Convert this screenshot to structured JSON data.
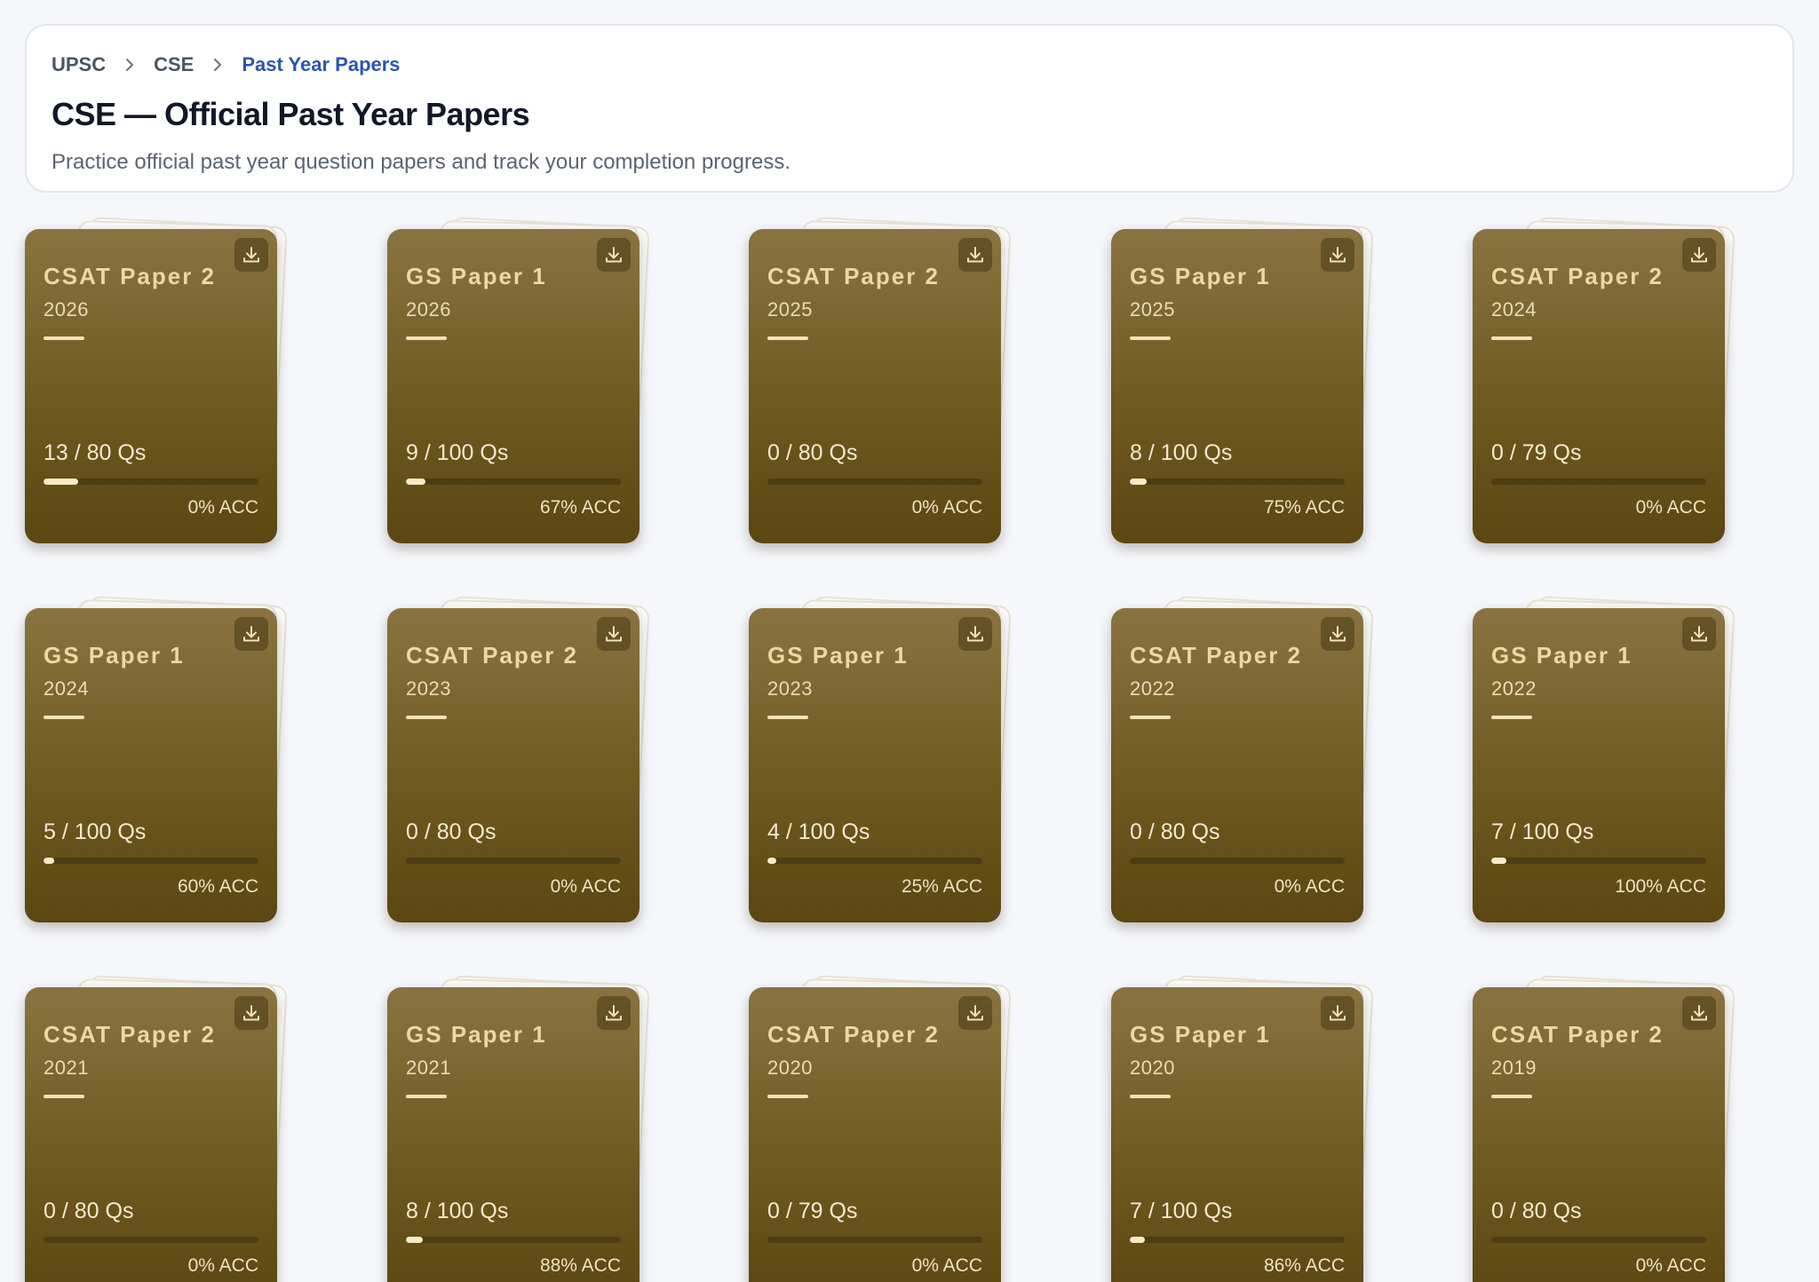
{
  "breadcrumb": [
    {
      "label": "UPSC"
    },
    {
      "label": "CSE"
    },
    {
      "label": "Past Year Papers"
    }
  ],
  "header": {
    "title": "CSE — Official Past Year Papers",
    "subtitle": "Practice official past year question papers and track your completion progress."
  },
  "papers": [
    {
      "title": "CSAT Paper 2",
      "year": "2026",
      "qs": "13 / 80 Qs",
      "done": 13,
      "total": 80,
      "acc": "0% ACC"
    },
    {
      "title": "GS Paper 1",
      "year": "2026",
      "qs": "9 / 100 Qs",
      "done": 9,
      "total": 100,
      "acc": "67% ACC"
    },
    {
      "title": "CSAT Paper 2",
      "year": "2025",
      "qs": "0 / 80 Qs",
      "done": 0,
      "total": 80,
      "acc": "0% ACC"
    },
    {
      "title": "GS Paper 1",
      "year": "2025",
      "qs": "8 / 100 Qs",
      "done": 8,
      "total": 100,
      "acc": "75% ACC"
    },
    {
      "title": "CSAT Paper 2",
      "year": "2024",
      "qs": "0 / 79 Qs",
      "done": 0,
      "total": 79,
      "acc": "0% ACC"
    },
    {
      "title": "GS Paper 1",
      "year": "2024",
      "qs": "5 / 100 Qs",
      "done": 5,
      "total": 100,
      "acc": "60% ACC"
    },
    {
      "title": "CSAT Paper 2",
      "year": "2023",
      "qs": "0 / 80 Qs",
      "done": 0,
      "total": 80,
      "acc": "0% ACC"
    },
    {
      "title": "GS Paper 1",
      "year": "2023",
      "qs": "4 / 100 Qs",
      "done": 4,
      "total": 100,
      "acc": "25% ACC"
    },
    {
      "title": "CSAT Paper 2",
      "year": "2022",
      "qs": "0 / 80 Qs",
      "done": 0,
      "total": 80,
      "acc": "0% ACC"
    },
    {
      "title": "GS Paper 1",
      "year": "2022",
      "qs": "7 / 100 Qs",
      "done": 7,
      "total": 100,
      "acc": "100% ACC"
    },
    {
      "title": "CSAT Paper 2",
      "year": "2021",
      "qs": "0 / 80 Qs",
      "done": 0,
      "total": 80,
      "acc": "0% ACC"
    },
    {
      "title": "GS Paper 1",
      "year": "2021",
      "qs": "8 / 100 Qs",
      "done": 8,
      "total": 100,
      "acc": "88% ACC"
    },
    {
      "title": "CSAT Paper 2",
      "year": "2020",
      "qs": "0 / 79 Qs",
      "done": 0,
      "total": 79,
      "acc": "0% ACC"
    },
    {
      "title": "GS Paper 1",
      "year": "2020",
      "qs": "7 / 100 Qs",
      "done": 7,
      "total": 100,
      "acc": "86% ACC"
    },
    {
      "title": "CSAT Paper 2",
      "year": "2019",
      "qs": "0 / 80 Qs",
      "done": 0,
      "total": 80,
      "acc": "0% ACC"
    }
  ],
  "icons": {
    "breadcrumb_separator": "chevron-right-icon",
    "card_action": "download-icon"
  },
  "colors": {
    "breadcrumb_active": "#2b55b5",
    "card_top": "#8a7341",
    "card_bottom": "#5c4612",
    "card_title": "#ecd9a0"
  }
}
